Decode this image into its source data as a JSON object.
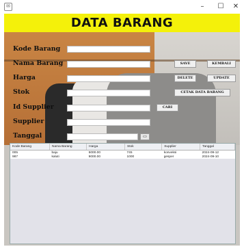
{
  "window": {
    "icon": "window-app-icon",
    "minimize": "–",
    "maximize": "☐",
    "close": "✕"
  },
  "header": {
    "title": "DATA BARANG",
    "bg_color": "#f4f10a"
  },
  "form": {
    "labels": {
      "kode": "Kode Barang",
      "nama": "Nama Barang",
      "harga": "Harga",
      "stok": "Stok",
      "id_supplier": "Id Supplier",
      "supplier": "Supplier",
      "tanggal": "Tanggal"
    },
    "values": {
      "kode": "",
      "nama": "",
      "harga": "",
      "stok": "",
      "id_supplier": "",
      "supplier": "",
      "tanggal": ""
    }
  },
  "buttons": {
    "save": "SAVE",
    "kembali": "KEMBALI",
    "delete": "DELETE",
    "update": "UPDATE",
    "cetak": "CETAK DATA BARANG",
    "cari": "CARI"
  },
  "table": {
    "headers": [
      "Kode Barang",
      "Nama Barang",
      "Harga",
      "Stok",
      "Supplier",
      "Tanggal"
    ],
    "rows": [
      [
        "005",
        "baju",
        "5000.00",
        "745",
        "konveksi",
        "2024-09-12"
      ],
      [
        "987",
        "kaluti",
        "9000.00",
        "1000",
        "gesper",
        "2024-09-10"
      ]
    ]
  }
}
